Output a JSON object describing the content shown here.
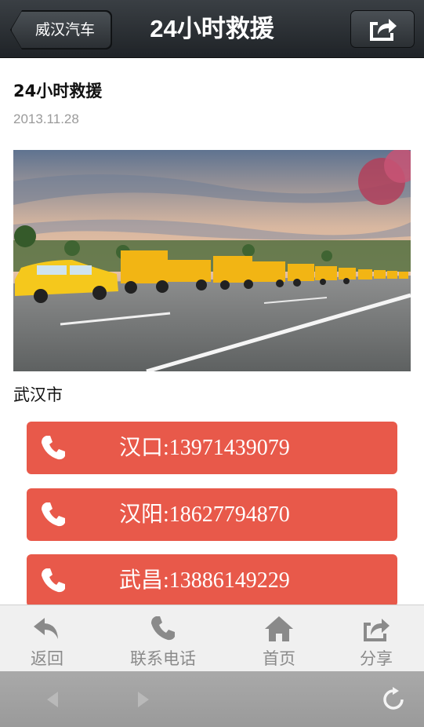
{
  "navbar": {
    "back_label": "威汉汽车",
    "title": "24小时救援"
  },
  "article": {
    "title": "24小时救援",
    "date": "2013.11.28",
    "city": "武汉市"
  },
  "call_buttons": [
    {
      "label": "汉口:13971439079"
    },
    {
      "label": "汉阳:18627794870"
    },
    {
      "label": "武昌:13886149229"
    }
  ],
  "tabbar": {
    "items": [
      {
        "label": "返回",
        "icon": "back-arrow-icon"
      },
      {
        "label": "联系电话",
        "icon": "phone-icon"
      },
      {
        "label": "首页",
        "icon": "home-icon"
      },
      {
        "label": "分享",
        "icon": "share-icon"
      }
    ]
  },
  "colors": {
    "accent": "#e8594a",
    "navbar": "#2b2f33",
    "tab_icon": "#8a8a8a"
  }
}
